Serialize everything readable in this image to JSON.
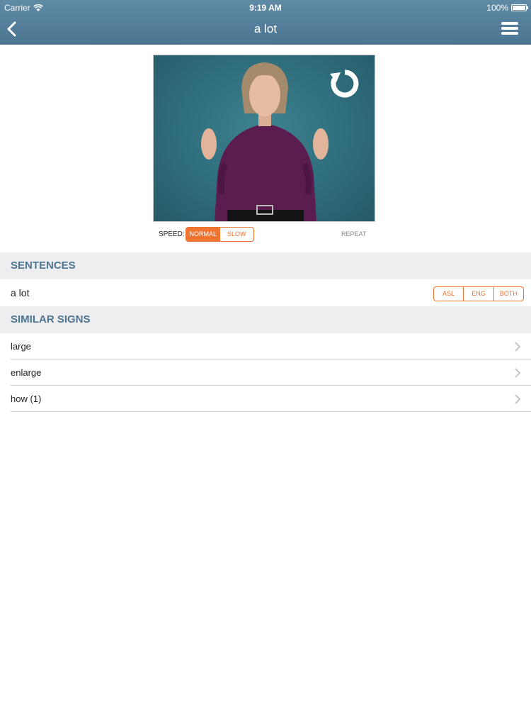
{
  "status": {
    "carrier": "Carrier",
    "time": "9:19 AM",
    "battery": "100%"
  },
  "nav": {
    "title": "a lot",
    "back_icon": "chevron-left-icon",
    "menu_icon": "hamburger-menu-icon"
  },
  "video": {
    "replay_icon": "replay-icon"
  },
  "speed": {
    "label": "SPEED:",
    "options": [
      "NORMAL",
      "SLOW"
    ],
    "selected": "NORMAL",
    "repeat_label": "REPEAT"
  },
  "sentences": {
    "header": "SENTENCES",
    "items": [
      {
        "text": "a lot",
        "options": [
          "ASL",
          "ENG",
          "BOTH"
        ]
      }
    ]
  },
  "similar": {
    "header": "SIMILAR SIGNS",
    "items": [
      "large",
      "enlarge",
      "how (1)"
    ]
  },
  "colors": {
    "nav_bar": "#5f8aa6",
    "accent": "#ee7430",
    "section_header_bg": "#eeeef0",
    "section_header_text": "#4c7592"
  }
}
